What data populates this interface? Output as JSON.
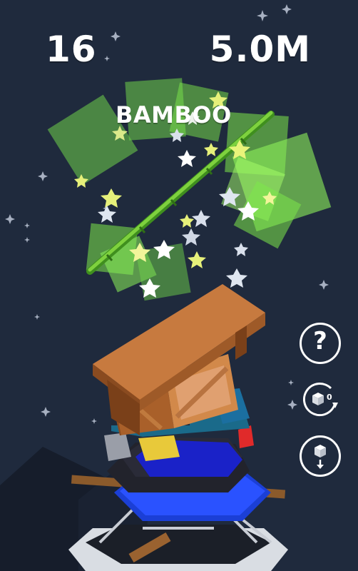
{
  "hud": {
    "score": "16",
    "height": "5.0M",
    "item_name": "BAMBOO"
  },
  "controls": {
    "help_symbol": "?",
    "rotate_count": "0",
    "help_icon": "question-mark-icon",
    "rotate_icon": "rotate-cube-icon",
    "drop_icon": "drop-cube-icon"
  },
  "colors": {
    "background": "#1f2a3d",
    "accent_green": "#7ee84a",
    "crate": "#c07a3e",
    "plank": "#b8683a",
    "tower_blue": "#2233cc"
  }
}
